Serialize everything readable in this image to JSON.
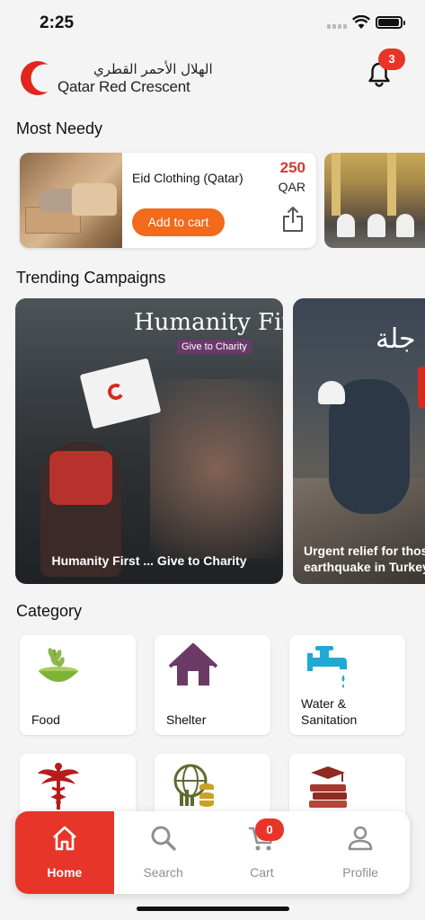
{
  "status_bar": {
    "time": "2:25"
  },
  "header": {
    "logo_arabic": "الهلال الأحمر القطري",
    "logo_english": "Qatar Red Crescent",
    "notification_count": "3"
  },
  "most_needy": {
    "title": "Most Needy",
    "items": [
      {
        "name": "Eid Clothing (Qatar)",
        "price": "250",
        "currency": "QAR",
        "add_to_cart": "Add to cart"
      }
    ]
  },
  "trending": {
    "title": "Trending Campaigns",
    "campaigns": [
      {
        "headline": "Humanity First",
        "subheadline": "Give to Charity",
        "caption": "Humanity First ... Give to Charity"
      },
      {
        "headline_arabic": "جلة",
        "caption_line1": "Urgent relief for thos",
        "caption_line2": "earthquake in Turkey"
      }
    ]
  },
  "category": {
    "title": "Category",
    "items": [
      {
        "label": "Food",
        "icon": "food-bowl-icon"
      },
      {
        "label": "Shelter",
        "icon": "house-icon"
      },
      {
        "label_line1": "Water &",
        "label_line2": "Sanitation",
        "icon": "water-tap-icon"
      },
      {
        "label": "",
        "icon": "medical-caduceus-icon"
      },
      {
        "label": "",
        "icon": "economic-globe-icon"
      },
      {
        "label": "",
        "icon": "education-books-icon"
      }
    ]
  },
  "bottom_nav": {
    "items": [
      {
        "label": "Home",
        "icon": "home-icon",
        "active": true
      },
      {
        "label": "Search",
        "icon": "search-icon",
        "active": false
      },
      {
        "label": "Cart",
        "icon": "cart-icon",
        "active": false
      },
      {
        "label": "Profile",
        "icon": "profile-icon",
        "active": false
      }
    ],
    "cart_count": "0"
  },
  "colors": {
    "accent_red": "#e8352a",
    "button_orange": "#f26a1c",
    "price_red": "#d23a33"
  }
}
